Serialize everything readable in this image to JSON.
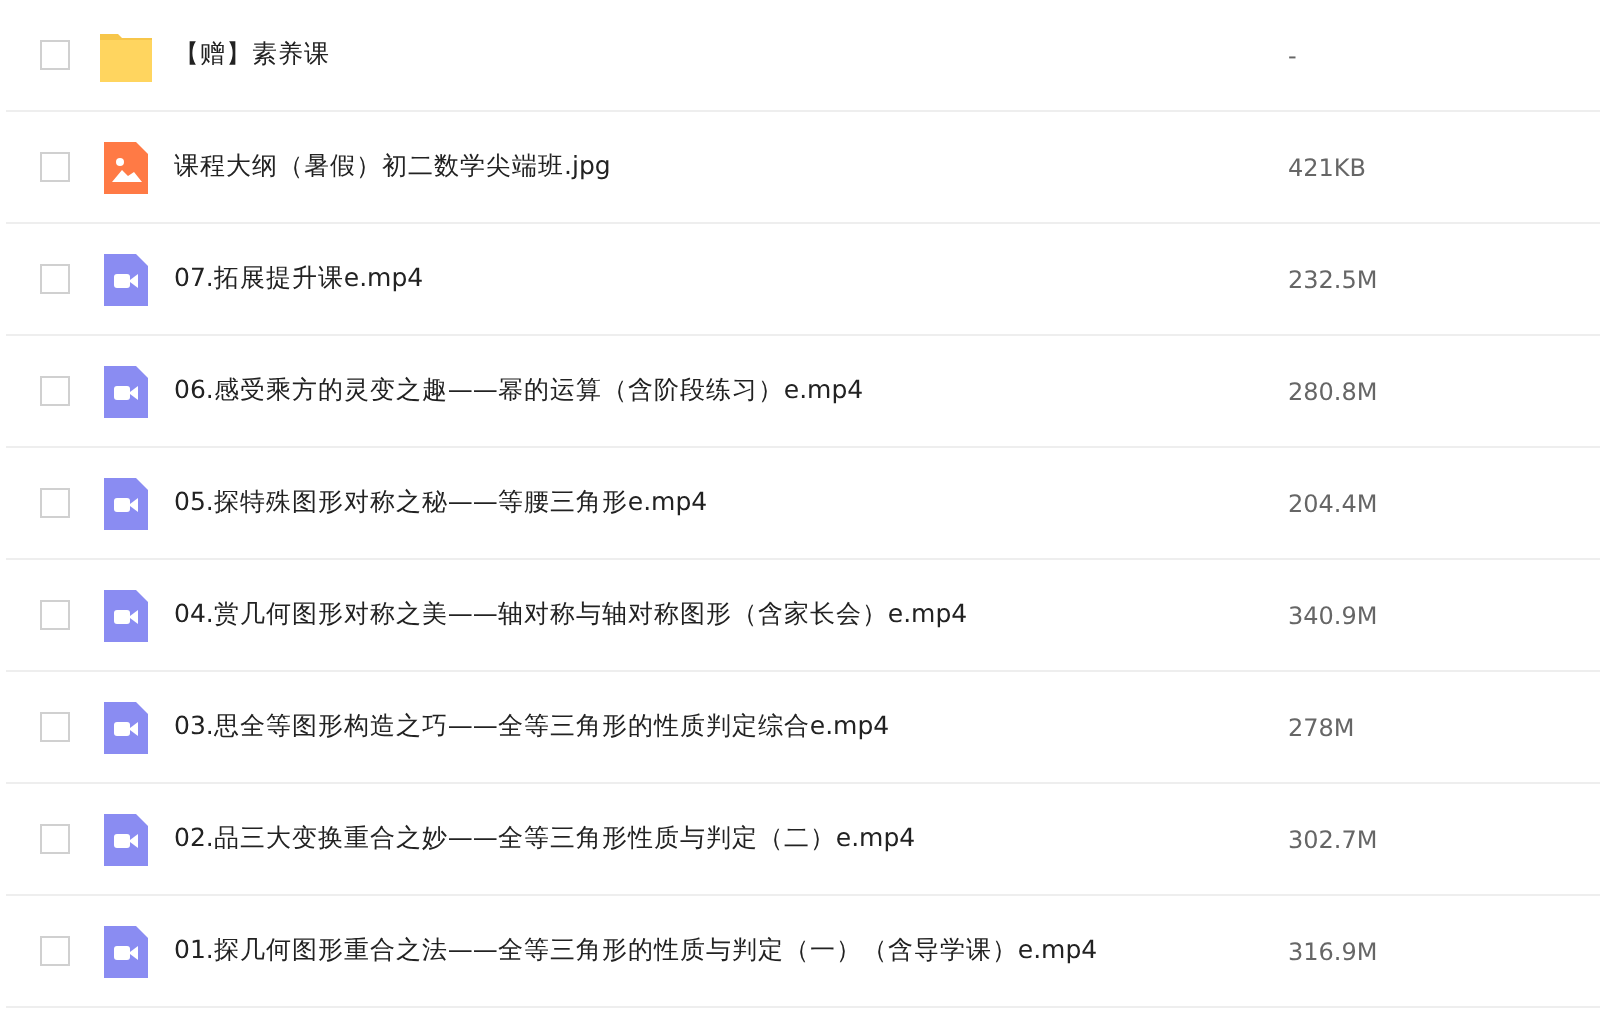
{
  "files": [
    {
      "kind": "folder",
      "name": "【赠】素养课",
      "size": "-",
      "checked": false
    },
    {
      "kind": "image",
      "name": "课程大纲（暑假）初二数学尖端班.jpg",
      "size": "421KB",
      "checked": false
    },
    {
      "kind": "video",
      "name": "07.拓展提升课e.mp4",
      "size": "232.5M",
      "checked": false
    },
    {
      "kind": "video",
      "name": "06.感受乘方的灵变之趣——幂的运算（含阶段练习）e.mp4",
      "size": "280.8M",
      "checked": false
    },
    {
      "kind": "video",
      "name": "05.探特殊图形对称之秘——等腰三角形e.mp4",
      "size": "204.4M",
      "checked": false
    },
    {
      "kind": "video",
      "name": "04.赏几何图形对称之美——轴对称与轴对称图形（含家长会）e.mp4",
      "size": "340.9M",
      "checked": false
    },
    {
      "kind": "video",
      "name": "03.思全等图形构造之巧——全等三角形的性质判定综合e.mp4",
      "size": "278M",
      "checked": false
    },
    {
      "kind": "video",
      "name": "02.品三大变换重合之妙——全等三角形性质与判定（二）e.mp4",
      "size": "302.7M",
      "checked": false
    },
    {
      "kind": "video",
      "name": "01.探几何图形重合之法——全等三角形的性质与判定（一）（含导学课）e.mp4",
      "size": "316.9M",
      "checked": false
    }
  ]
}
